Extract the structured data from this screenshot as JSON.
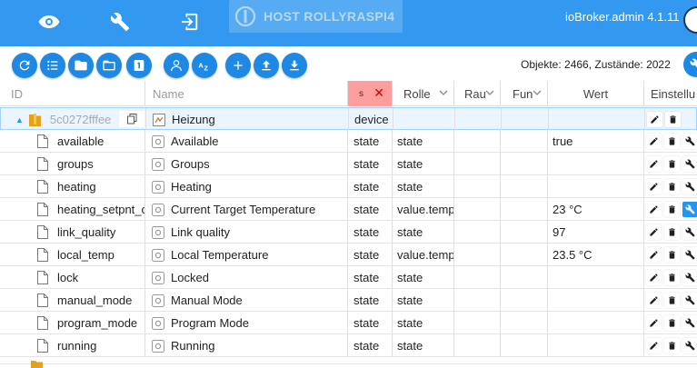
{
  "topbar": {
    "host_label": "HOST ROLLYRASPI4",
    "version": "ioBroker.admin 4.1.11",
    "icons": [
      "eye-icon",
      "wrench-icon",
      "logout-icon"
    ]
  },
  "toolbar": {
    "buttons": [
      "refresh-icon",
      "list-icon",
      "folder-icon",
      "folder-open-icon",
      "number-one-icon",
      "person-icon",
      "sort-az-icon",
      "add-icon",
      "upload-icon",
      "download-icon"
    ],
    "counts": "Objekte: 2466, Zustände: 2022"
  },
  "columns": {
    "id": "ID",
    "name": "Name",
    "type": "s",
    "role": "Rolle",
    "room": "Rau",
    "function": "Fun",
    "value": "Wert",
    "settings": "Einstellu"
  },
  "parent_row": {
    "id": "5c0272fffee",
    "name": "Heizung",
    "type": "device"
  },
  "rows": [
    {
      "id": "available",
      "name": "Available",
      "type": "state",
      "role": "state",
      "value": "true"
    },
    {
      "id": "groups",
      "name": "Groups",
      "type": "state",
      "role": "state",
      "value": ""
    },
    {
      "id": "heating",
      "name": "Heating",
      "type": "state",
      "role": "state",
      "value": ""
    },
    {
      "id": "heating_setpnt_c",
      "name": "Current Target Temperature",
      "type": "state",
      "role": "value.temp",
      "value": "23 °C"
    },
    {
      "id": "link_quality",
      "name": "Link quality",
      "type": "state",
      "role": "state",
      "value": "97"
    },
    {
      "id": "local_temp",
      "name": "Local Temperature",
      "type": "state",
      "role": "value.temp",
      "value": "23.5 °C"
    },
    {
      "id": "lock",
      "name": "Locked",
      "type": "state",
      "role": "state",
      "value": ""
    },
    {
      "id": "manual_mode",
      "name": "Manual Mode",
      "type": "state",
      "role": "state",
      "value": ""
    },
    {
      "id": "program_mode",
      "name": "Program Mode",
      "type": "state",
      "role": "state",
      "value": ""
    },
    {
      "id": "running",
      "name": "Running",
      "type": "state",
      "role": "state",
      "value": ""
    }
  ],
  "colors": {
    "topbar": "#3399f0",
    "button": "#1e88e5",
    "selected_row": "#eaf5ff",
    "type_filter": "#ff9e9e"
  }
}
